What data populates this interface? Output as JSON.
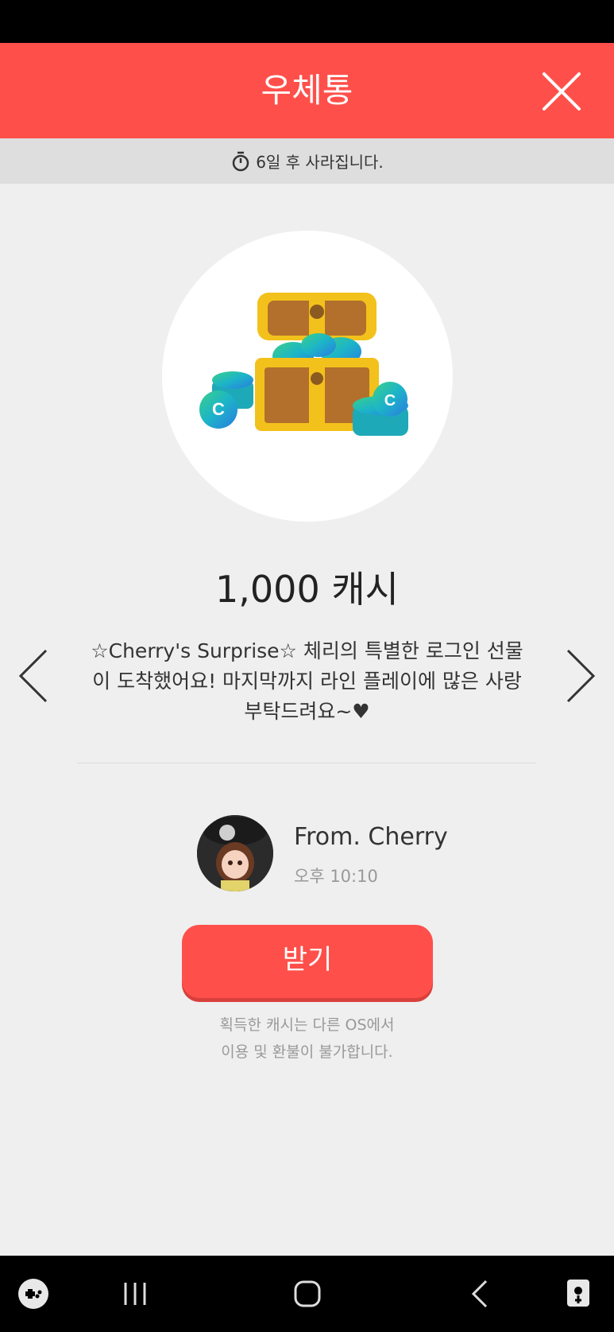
{
  "header": {
    "title": "우체통"
  },
  "timer": {
    "text": "6일 후 사라집니다."
  },
  "gift": {
    "amount": "1,000 캐시",
    "message": "☆Cherry's Surprise☆ 체리의 특별한 로그인 선물이 도착했어요! 마지막까지 라인 플레이에 많은 사랑 부탁드려요~♥"
  },
  "sender": {
    "from": "From. Cherry",
    "time": "오후 10:10"
  },
  "action": {
    "receive_label": "받기"
  },
  "notice": {
    "line1": "획득한 캐시는 다른 OS에서",
    "line2": "이용 및 환불이 불가합니다."
  },
  "colors": {
    "accent": "#ff4f4a",
    "timer_bar": "#dedede",
    "background": "#efefef"
  },
  "icons": [
    "close-icon",
    "timer-icon",
    "chevron-left-icon",
    "chevron-right-icon",
    "game-launcher-icon",
    "recent-apps-icon",
    "home-icon",
    "back-icon",
    "assist-icon"
  ]
}
